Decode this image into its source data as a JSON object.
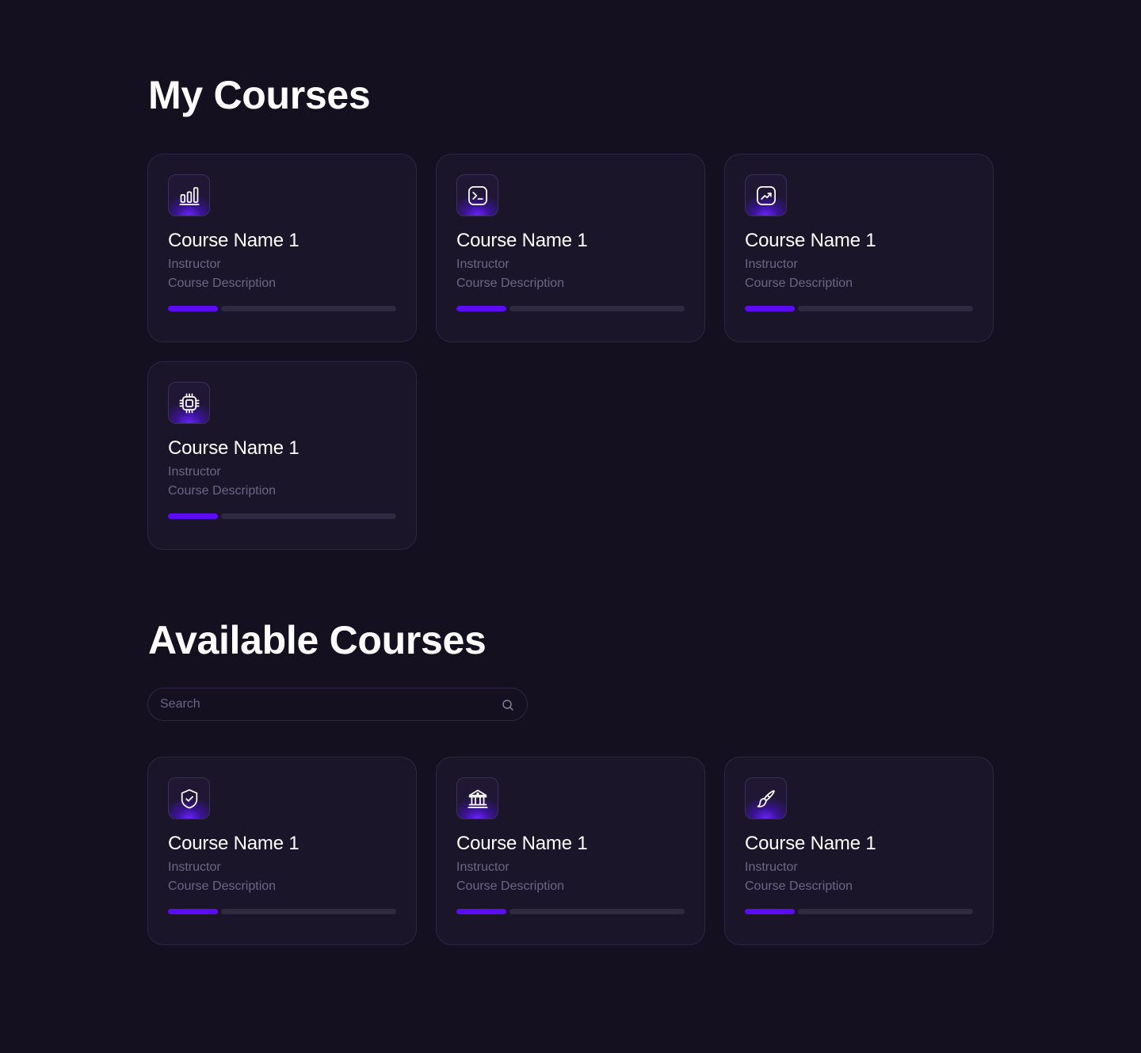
{
  "my_courses": {
    "title": "My Courses",
    "courses": [
      {
        "icon": "bar-chart-icon",
        "name": "Course Name 1",
        "instructor": "Instructor",
        "description": "Course Description",
        "progress": 0.22
      },
      {
        "icon": "terminal-icon",
        "name": "Course Name 1",
        "instructor": "Instructor",
        "description": "Course Description",
        "progress": 0.22
      },
      {
        "icon": "trending-chart-icon",
        "name": "Course Name 1",
        "instructor": "Instructor",
        "description": "Course Description",
        "progress": 0.22
      },
      {
        "icon": "cpu-chip-icon",
        "name": "Course Name 1",
        "instructor": "Instructor",
        "description": "Course Description",
        "progress": 0.22
      }
    ]
  },
  "available_courses": {
    "title": "Available Courses",
    "search": {
      "placeholder": "Search",
      "value": ""
    },
    "courses": [
      {
        "icon": "shield-check-icon",
        "name": "Course Name 1",
        "instructor": "Instructor",
        "description": "Course Description",
        "progress": 0.22
      },
      {
        "icon": "bank-building-icon",
        "name": "Course Name 1",
        "instructor": "Instructor",
        "description": "Course Description",
        "progress": 0.22
      },
      {
        "icon": "paint-brush-icon",
        "name": "Course Name 1",
        "instructor": "Instructor",
        "description": "Course Description",
        "progress": 0.22
      }
    ]
  },
  "colors": {
    "background": "#14101f",
    "card": "#1b1529",
    "accent": "#5b0cf5",
    "muted_text": "#6d6685"
  }
}
